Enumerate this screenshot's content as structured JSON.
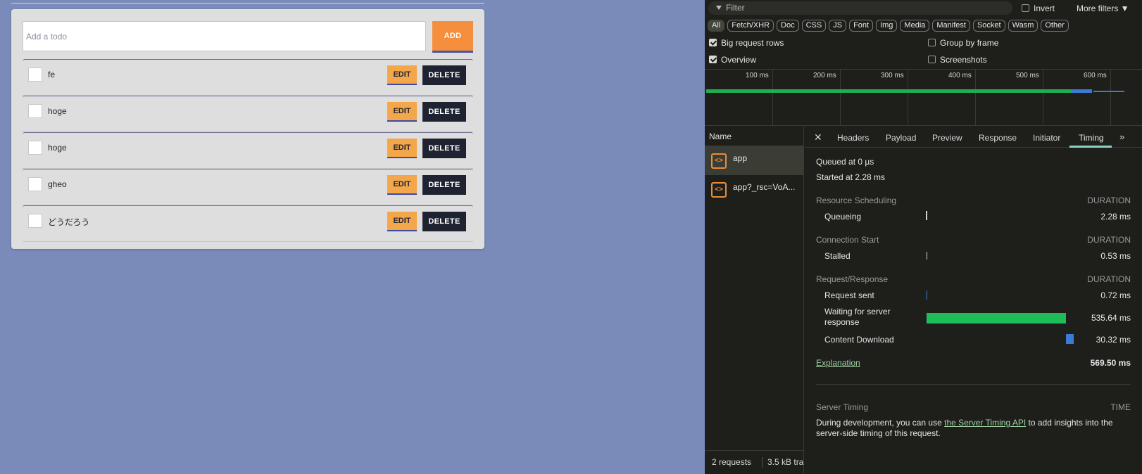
{
  "todo": {
    "input_placeholder": "Add a todo",
    "add_label": "ADD",
    "edit_label": "EDIT",
    "delete_label": "DELETE",
    "items": [
      {
        "text": "fe"
      },
      {
        "text": "hoge"
      },
      {
        "text": "hoge"
      },
      {
        "text": "gheo"
      },
      {
        "text": "どうだろう"
      }
    ]
  },
  "devtools": {
    "filter_placeholder": "Filter",
    "invert_label": "Invert",
    "more_filters_label": "More filters ▼",
    "type_filters": [
      "All",
      "Fetch/XHR",
      "Doc",
      "CSS",
      "JS",
      "Font",
      "Img",
      "Media",
      "Manifest",
      "Socket",
      "Wasm",
      "Other"
    ],
    "active_type": "All",
    "options": {
      "big_request_rows": {
        "label": "Big request rows",
        "checked": true
      },
      "overview": {
        "label": "Overview",
        "checked": true
      },
      "group_by_frame": {
        "label": "Group by frame",
        "checked": false
      },
      "screenshots": {
        "label": "Screenshots",
        "checked": false
      }
    },
    "timeline_ticks": [
      "100 ms",
      "200 ms",
      "300 ms",
      "400 ms",
      "500 ms",
      "600 ms"
    ],
    "name_header": "Name",
    "requests": [
      {
        "name": "app",
        "icon": "document-icon",
        "selected": true
      },
      {
        "name": "app?_rsc=VoA...",
        "icon": "document-icon",
        "selected": false
      }
    ],
    "status": {
      "requests": "2 requests",
      "transferred": "3.5 kB tra"
    },
    "tabs": [
      "Headers",
      "Payload",
      "Preview",
      "Response",
      "Initiator",
      "Timing"
    ],
    "active_tab": "Timing",
    "timing": {
      "queued": "Queued at 0 µs",
      "started": "Started at 2.28 ms",
      "duration_label": "DURATION",
      "sections": [
        {
          "title": "Resource Scheduling",
          "rows": [
            {
              "label": "Queueing",
              "value": "2.28 ms",
              "ms": 2.28,
              "color": "#d0d0d0"
            }
          ]
        },
        {
          "title": "Connection Start",
          "rows": [
            {
              "label": "Stalled",
              "value": "0.53 ms",
              "ms": 0.53,
              "color": "#d0d0d0"
            }
          ]
        },
        {
          "title": "Request/Response",
          "rows": [
            {
              "label": "Request sent",
              "value": "0.72 ms",
              "ms": 0.72,
              "color": "#3b7bd8"
            },
            {
              "label": "Waiting for server response",
              "value": "535.64 ms",
              "ms": 535.64,
              "color": "#1fbd5a"
            },
            {
              "label": "Content Download",
              "value": "30.32 ms",
              "ms": 30.32,
              "color": "#3b7bd8"
            }
          ]
        }
      ],
      "explanation_label": "Explanation",
      "total": "569.50 ms",
      "server_timing_title": "Server Timing",
      "server_timing_time_label": "TIME",
      "server_timing_text_before": "During development, you can use ",
      "server_timing_link": "the Server Timing API",
      "server_timing_text_after": " to add insights into the server-side timing of this request."
    }
  }
}
